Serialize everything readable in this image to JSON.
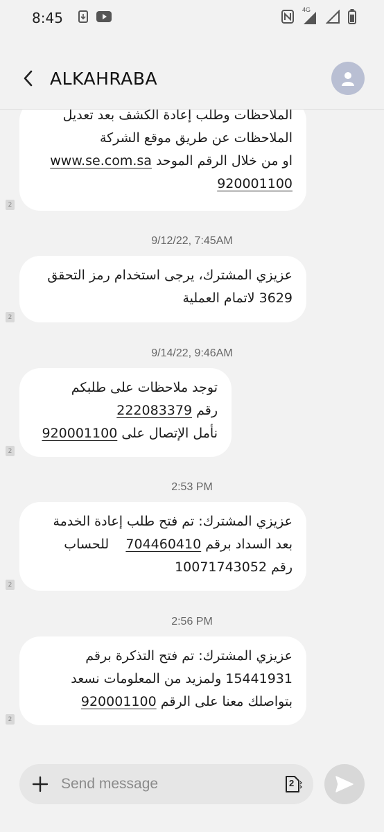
{
  "status_bar": {
    "time": "8:45",
    "left_icons": [
      "download-icon",
      "youtube-icon"
    ],
    "right_icons": [
      "nfc-icon",
      "signal-4g-icon",
      "signal-icon",
      "battery-icon"
    ],
    "network": "4G"
  },
  "header": {
    "contact_name": "ALKAHRABA"
  },
  "messages": [
    {
      "lines": [
        "الملاحظات وطلب إعادة الكشف بعد تعديل",
        "الملاحظات عن طريق موقع الشركة",
        "او من خلال الرقم الموحد",
        "920001100"
      ],
      "link": "www.se.com.sa",
      "sim": "2"
    },
    {
      "timestamp": "9/12/22, 7:45AM",
      "lines": [
        "عزيزي المشترك، يرجى استخدام رمز التحقق",
        "3629 لاتمام العملية"
      ],
      "sim": "2"
    },
    {
      "timestamp": "9/14/22, 9:46AM",
      "lines": [
        "توجد ملاحظات على طلبكم",
        "رقم",
        "222083379",
        "نأمل الإتصال على",
        "920001100"
      ],
      "sim": "2"
    },
    {
      "timestamp": "2:53 PM",
      "lines": [
        "عزيزي المشترك: تم فتح طلب إعادة الخدمة",
        "بعد السداد برقم",
        "704460410",
        "للحساب",
        "رقم 10071743052"
      ],
      "sim": "2"
    },
    {
      "timestamp": "2:56 PM",
      "lines": [
        "عزيزي المشترك: تم فتح التذكرة برقم",
        "15441931 ولمزيد من المعلومات نسعد",
        "بتواصلك معنا على الرقم",
        "920001100"
      ],
      "sim": "2"
    }
  ],
  "composer": {
    "placeholder": "Send message",
    "sim_label": "2"
  },
  "colors": {
    "background": "#f2f2f2",
    "bubble": "#ffffff",
    "avatar": "#b9bfd3",
    "send_button": "#d8d8d8"
  }
}
